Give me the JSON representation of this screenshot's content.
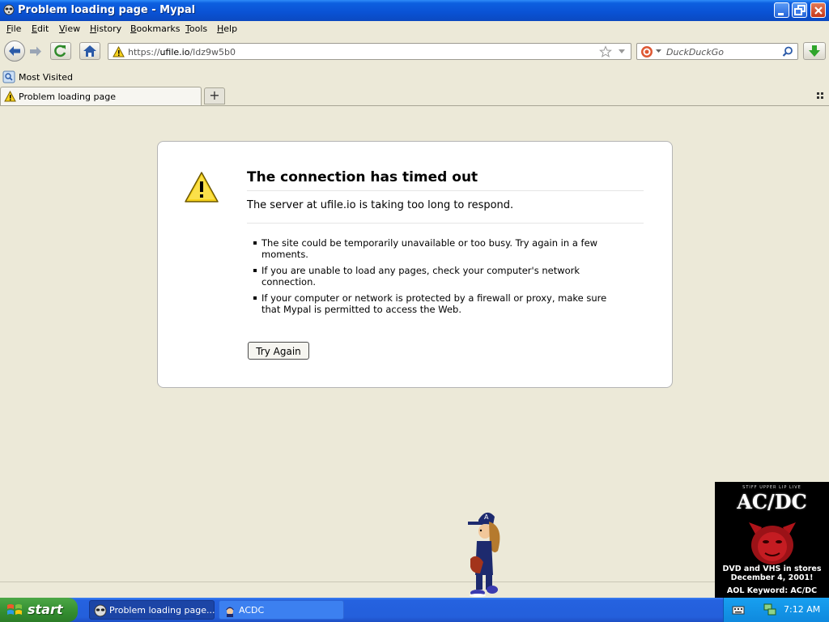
{
  "window": {
    "title": "Problem loading page - Mypal"
  },
  "menu": [
    "File",
    "Edit",
    "View",
    "History",
    "Bookmarks",
    "Tools",
    "Help"
  ],
  "navbar": {
    "url_prefix": "https://",
    "url_host": "ufile.io",
    "url_path": "/ldz9w5b0",
    "search_placeholder": "DuckDuckGo"
  },
  "bookmarks": {
    "most_visited": "Most Visited"
  },
  "tabs": {
    "active_label": "Problem loading page",
    "new_tab": "+"
  },
  "error": {
    "title": "The connection has timed out",
    "short_desc": "The server at ufile.io is taking too long to respond.",
    "items": [
      "The site could be temporarily unavailable or too busy. Try again in a few moments.",
      "If you are unable to load any pages, check your computer's network connection.",
      "If your computer or network is protected by a firewall or proxy, make sure that Mypal is permitted to access the Web."
    ],
    "try_again": "Try Again"
  },
  "ad": {
    "small_text": "STIFF UPPER LIP LIVE",
    "logo": "AC/DC",
    "line1": "DVD and VHS in stores",
    "line2": "December 4, 2001!",
    "line3": "AOL Keyword: AC/DC"
  },
  "taskbar": {
    "start": "start",
    "tasks": [
      "Problem loading page...",
      "ACDC"
    ],
    "clock": "7:12 AM"
  },
  "colors": {
    "title_bar": "#0a52d4",
    "taskbar": "#245fdb",
    "start": "#338d30"
  }
}
